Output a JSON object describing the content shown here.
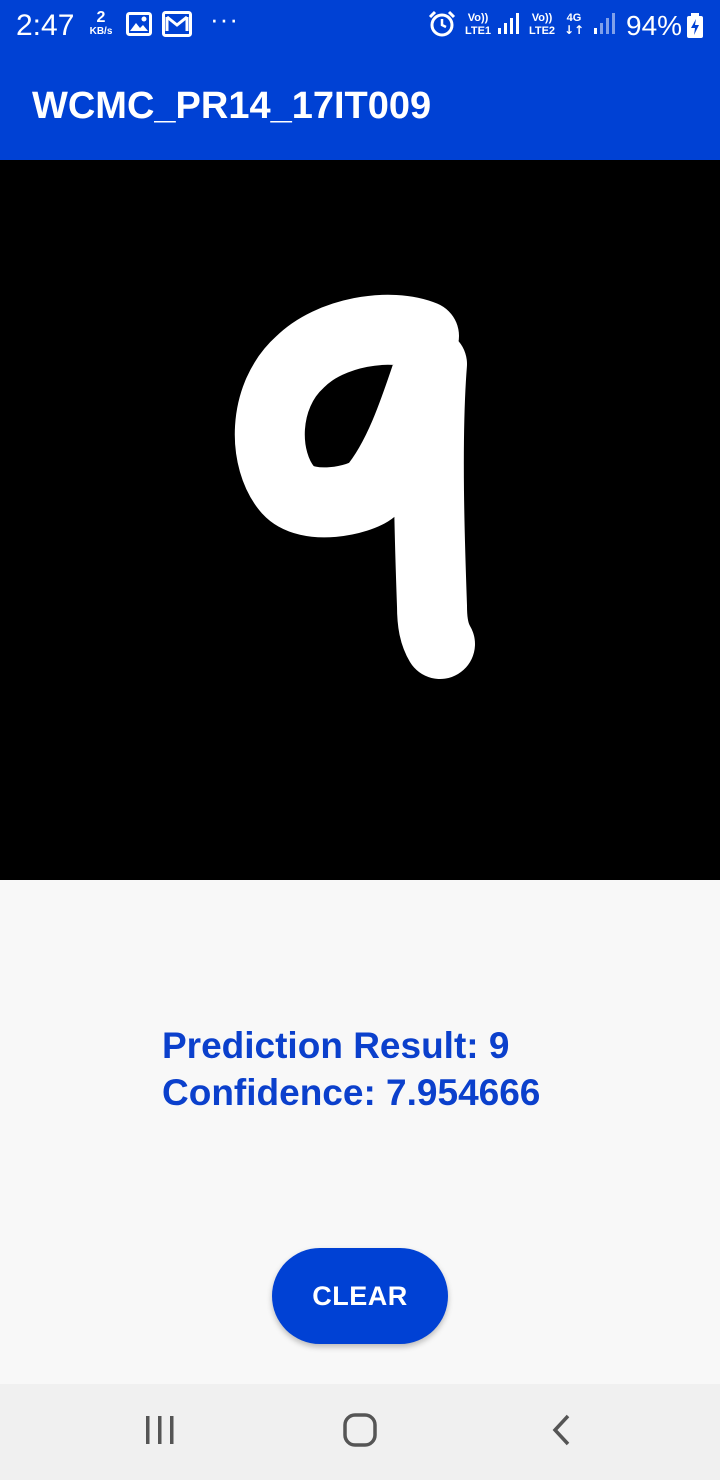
{
  "status_bar": {
    "time": "2:47",
    "speed_value": "2",
    "speed_unit": "KB/s",
    "sim1_label": "Vo)) LTE1",
    "sim2_label": "Vo)) LTE2",
    "network_type": "4G",
    "battery_percent": "94%",
    "icons": [
      "gallery-icon",
      "mail-icon",
      "more-icon",
      "alarm-icon",
      "signal-icon",
      "battery-charging-icon"
    ]
  },
  "app_bar": {
    "title": "WCMC_PR14_17IT009",
    "color": "#0041d4"
  },
  "canvas": {
    "background": "#000000",
    "stroke_color": "#ffffff"
  },
  "result": {
    "prediction_line": "Prediction Result: 9",
    "confidence_line": "Confidence: 7.954666",
    "color": "#0b40cc"
  },
  "clear_button": {
    "label": "CLEAR"
  },
  "nav_bar": {
    "items": [
      "recent-apps-icon",
      "home-icon",
      "back-icon"
    ]
  }
}
